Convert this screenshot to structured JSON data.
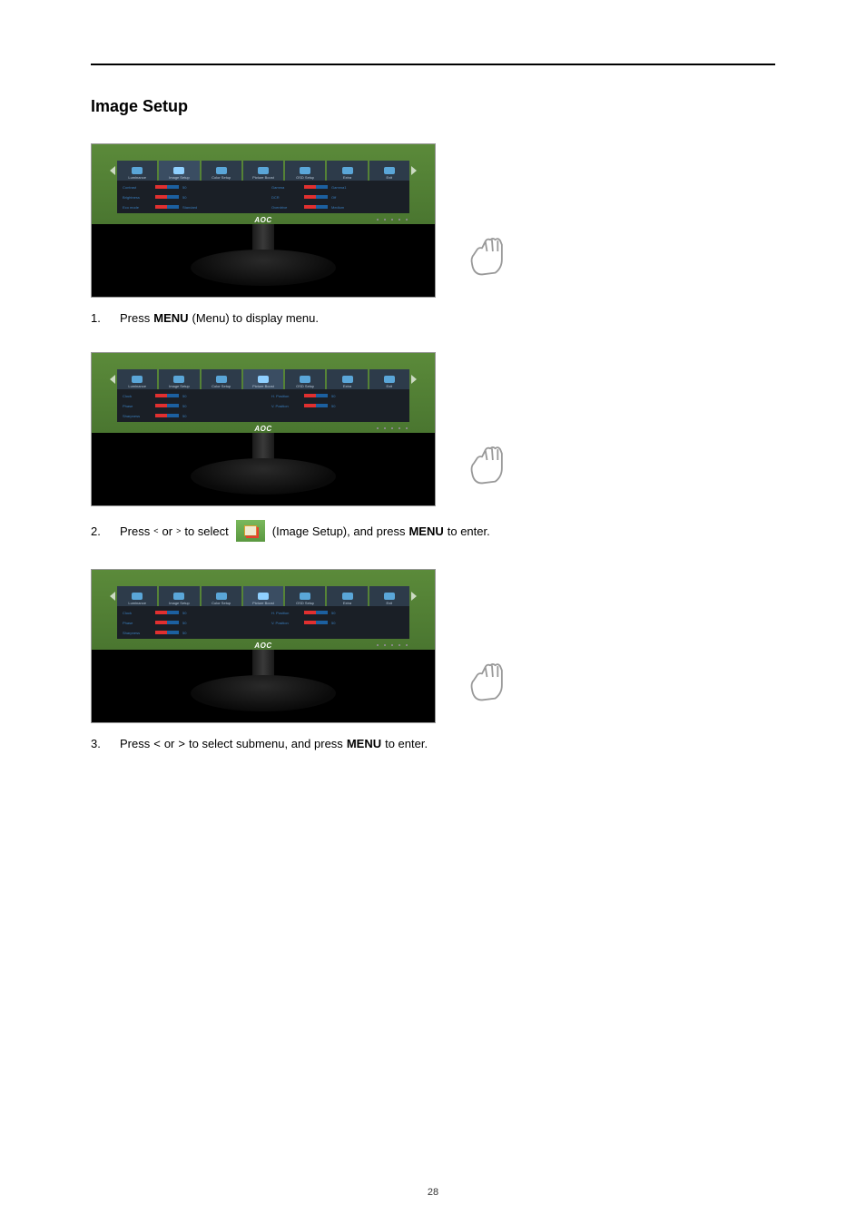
{
  "section_title": "Image Setup",
  "page_number": "28",
  "brand_logo": "AOC",
  "osd": {
    "tabs": [
      {
        "label": "Luminance"
      },
      {
        "label": "Image Setup"
      },
      {
        "label": "Color Setup"
      },
      {
        "label": "Picture Boost"
      },
      {
        "label": "OSD Setup"
      },
      {
        "label": "Extra"
      },
      {
        "label": "Exit"
      }
    ],
    "img1": {
      "selected_tab_index": 1,
      "left": [
        {
          "label": "Contrast",
          "value": "50"
        },
        {
          "label": "Brightness",
          "value": "50"
        },
        {
          "label": "Eco mode",
          "value": "Standard"
        }
      ],
      "right": [
        {
          "label": "Gamma",
          "value": "Gamma1"
        },
        {
          "label": "DCR",
          "value": "Off"
        },
        {
          "label": "Overdrive",
          "value": "Medium"
        }
      ]
    },
    "img2": {
      "selected_tab_index": 3,
      "left": [
        {
          "label": "Clock",
          "value": "50"
        },
        {
          "label": "Phase",
          "value": "50"
        },
        {
          "label": "Sharpness",
          "value": "50"
        }
      ],
      "right": [
        {
          "label": "H. Position",
          "value": "50"
        },
        {
          "label": "V. Position",
          "value": "50"
        }
      ]
    },
    "img3": {
      "selected_tab_index": 3,
      "left": [
        {
          "label": "Clock",
          "value": "50"
        },
        {
          "label": "Phase",
          "value": "50"
        },
        {
          "label": "Sharpness",
          "value": "50"
        }
      ],
      "right": [
        {
          "label": "H. Position",
          "value": "50"
        },
        {
          "label": "V. Position",
          "value": "50"
        }
      ]
    }
  },
  "steps": {
    "s1": {
      "num": "1.",
      "pre": "Press ",
      "bold": "MENU",
      "post": " (Menu) to display menu."
    },
    "s2": {
      "num": "2.",
      "pre": "Press ",
      "lt": "<",
      "or1": " or ",
      "gt": ">",
      "mid": "  to select ",
      "icon_desc": " (Image Setup), and press ",
      "bold": "MENU",
      "post": " to enter."
    },
    "s3": {
      "num": "3.",
      "pre": "Press ",
      "lt2": "<",
      "or2": " or  ",
      "gt2": ">",
      "mid2": "  to select submenu, and press ",
      "bold": "MENU",
      "post": " to enter."
    }
  }
}
